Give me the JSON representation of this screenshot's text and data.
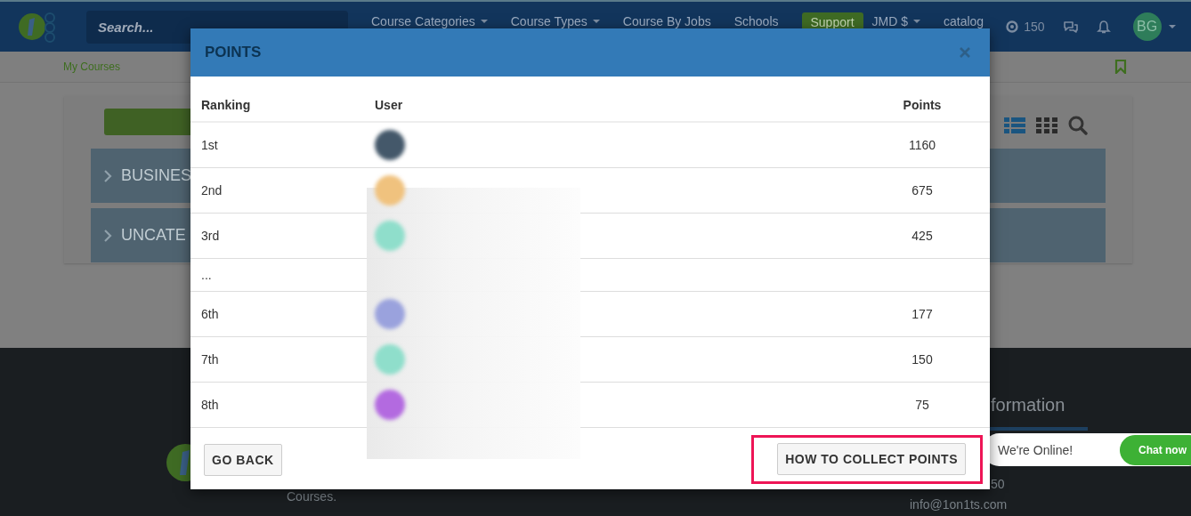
{
  "navbar": {
    "search": {
      "placeholder": "Search..."
    },
    "menu": [
      {
        "label": "Course Categories",
        "kind": "dropdown"
      },
      {
        "label": "Course Types",
        "kind": "dropdown"
      },
      {
        "label": "Course By Jobs",
        "kind": "link"
      },
      {
        "label": "Schools",
        "kind": "link"
      },
      {
        "label": "Support",
        "kind": "button"
      },
      {
        "label": "JMD $",
        "kind": "dropdown"
      },
      {
        "label": "catalog",
        "kind": "link"
      }
    ],
    "points": "150",
    "avatar": "BG"
  },
  "subnav": {
    "link": "My Courses"
  },
  "content": {
    "accordion": [
      "BUSINES",
      "UNCATE"
    ]
  },
  "modal": {
    "title": "POINTS",
    "columns": [
      "Ranking",
      "User",
      "Points"
    ],
    "rows": [
      {
        "kind": "entry",
        "rank": "1st",
        "color": "#44586a",
        "points": "1160"
      },
      {
        "kind": "entry",
        "rank": "2nd",
        "color": "#f0c27e",
        "points": "675"
      },
      {
        "kind": "entry",
        "rank": "3rd",
        "color": "#8fdecb",
        "points": "425"
      },
      {
        "kind": "gap",
        "rank": "..."
      },
      {
        "kind": "entry",
        "rank": "6th",
        "color": "#9aa2dd",
        "points": "177"
      },
      {
        "kind": "entry",
        "rank": "7th",
        "color": "#8fdecb",
        "points": "150"
      },
      {
        "kind": "entry",
        "rank": "8th",
        "color": "#b36ae0",
        "points": "75"
      }
    ],
    "buttons": [
      {
        "label": "GO BACK",
        "highlighted": false
      },
      {
        "label": "HOW TO COLLECT POINTS",
        "highlighted": true
      }
    ]
  },
  "footer": {
    "tagline": "Courses.",
    "heading": "formation",
    "phone": "50",
    "email": "info@1on1ts.com"
  },
  "chat": {
    "status": "We're Online!",
    "button": "Chat now"
  }
}
